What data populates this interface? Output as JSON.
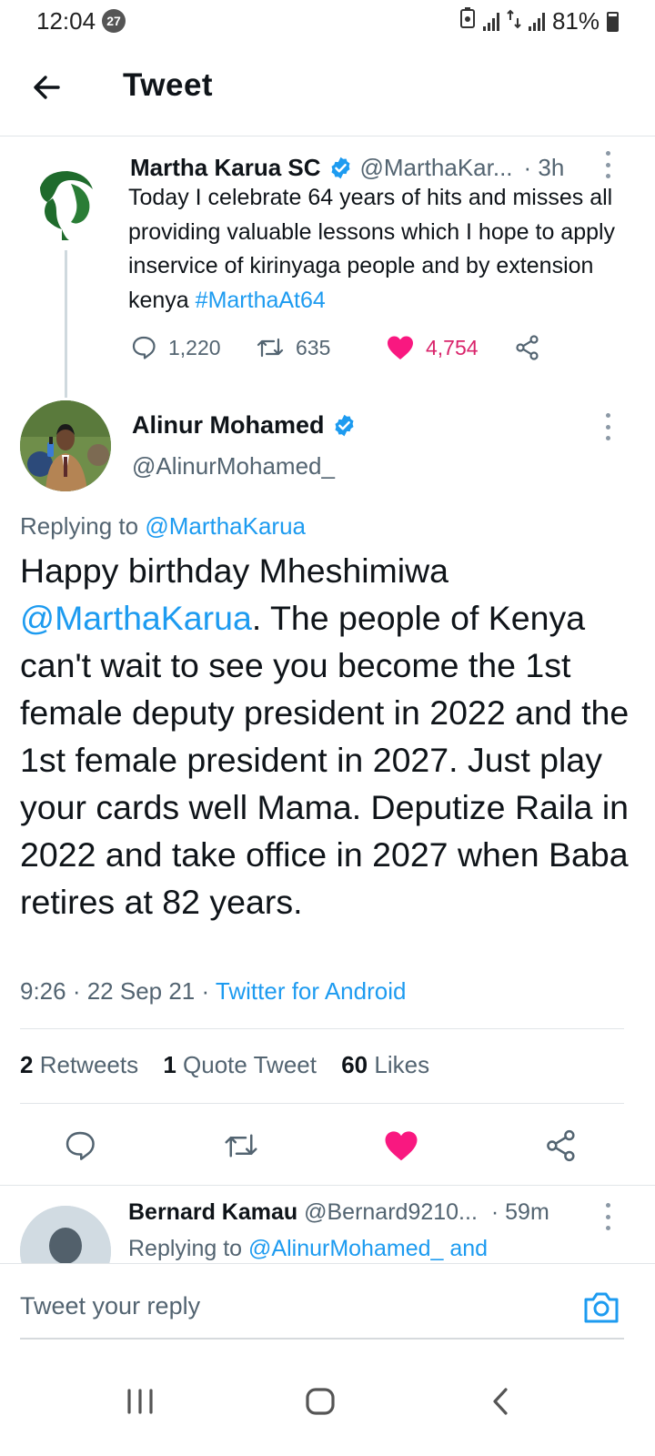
{
  "status_bar": {
    "time": "12:04",
    "notification_count": "27",
    "battery": "81%"
  },
  "header": {
    "title": "Tweet"
  },
  "parent_tweet": {
    "name": "Martha Karua SC",
    "handle": "@MarthaKar...",
    "time": "· 3h",
    "text_main": "Today I celebrate 64 years of hits and misses all providing valuable lessons which I hope to apply inservice of kirinyaga people and by extension kenya ",
    "hashtag": "#MarthaAt64",
    "replies": "1,220",
    "retweets": "635",
    "likes": "4,754"
  },
  "main_tweet": {
    "name": "Alinur Mohamed",
    "handle": "@AlinurMohamed_",
    "replying_label": "Replying to ",
    "replying_to": "@MarthaKarua",
    "text_prefix": "Happy birthday Mheshimiwa ",
    "mention": "@MarthaKarua",
    "text_rest": ". The people of Kenya can't wait to see you become the 1st female deputy president in 2022 and the 1st female president in 2027. Just play your cards well Mama. Deputize Raila in 2022 and take office in 2027 when Baba retires at 82 years.",
    "timestamp": "9:26 · 22 Sep 21 · ",
    "source": "Twitter for Android",
    "retweets_count": "2",
    "retweets_label": "Retweets",
    "quotes_count": "1",
    "quotes_label": "Quote Tweet",
    "likes_count": "60",
    "likes_label": "Likes"
  },
  "reply_preview": {
    "name": "Bernard Kamau",
    "handle": "@Bernard9210...",
    "time": "· 59m",
    "replying_label": "Replying to ",
    "replying_to": "@AlinurMohamed_",
    "and_label": "and"
  },
  "composer": {
    "placeholder": "Tweet your reply"
  },
  "colors": {
    "accent": "#1d9bf0",
    "like": "#f91880",
    "text": "#0f1419",
    "secondary": "#536471"
  }
}
